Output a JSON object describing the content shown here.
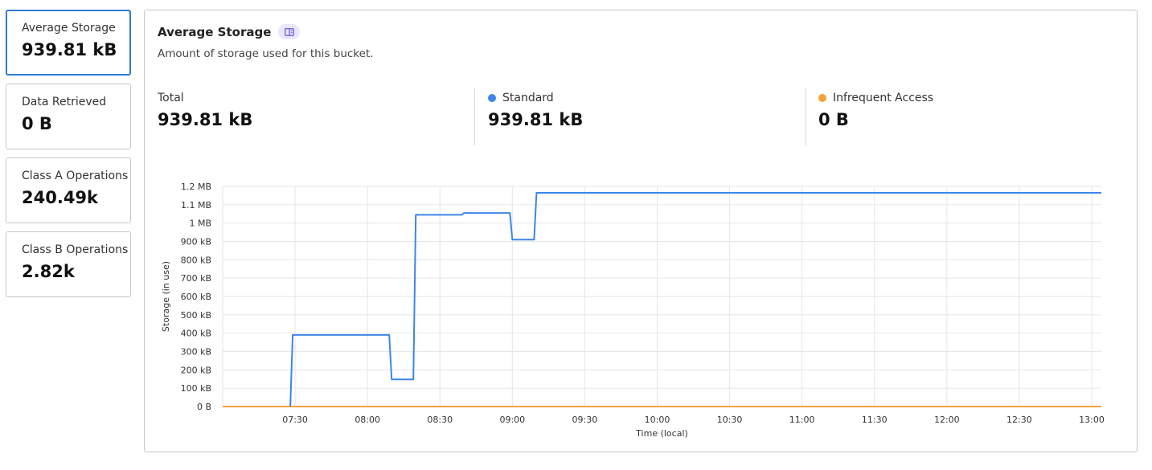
{
  "sidebar": {
    "cards": [
      {
        "label": "Average Storage",
        "value": "939.81 kB",
        "active": true
      },
      {
        "label": "Data Retrieved",
        "value": "0 B",
        "active": false
      },
      {
        "label": "Class A Operations",
        "value": "240.49k",
        "active": false
      },
      {
        "label": "Class B Operations",
        "value": "2.82k",
        "active": false
      }
    ]
  },
  "panel": {
    "title": "Average Storage",
    "subtitle": "Amount of storage used for this bucket.",
    "docs_icon": "book-icon",
    "stats": [
      {
        "label": "Total",
        "value": "939.81 kB"
      },
      {
        "label": "Standard",
        "value": "939.81 kB",
        "color": "#3b86e8"
      },
      {
        "label": "Infrequent Access",
        "value": "0 B",
        "color": "#f5a23a"
      }
    ]
  },
  "chart_data": {
    "type": "line",
    "title": "",
    "xlabel": "Time (local)",
    "ylabel": "Storage (in use)",
    "y_unit": "kB",
    "ylim": [
      0,
      1200
    ],
    "xlim": [
      "07:00",
      "13:04"
    ],
    "y_ticks": [
      {
        "value": 0,
        "label": "0 B"
      },
      {
        "value": 100,
        "label": "100 kB"
      },
      {
        "value": 200,
        "label": "200 kB"
      },
      {
        "value": 300,
        "label": "300 kB"
      },
      {
        "value": 400,
        "label": "400 kB"
      },
      {
        "value": 500,
        "label": "500 kB"
      },
      {
        "value": 600,
        "label": "600 kB"
      },
      {
        "value": 700,
        "label": "700 kB"
      },
      {
        "value": 800,
        "label": "800 kB"
      },
      {
        "value": 900,
        "label": "900 kB"
      },
      {
        "value": 1000,
        "label": "1 MB"
      },
      {
        "value": 1100,
        "label": "1.1 MB"
      },
      {
        "value": 1200,
        "label": "1.2 MB"
      }
    ],
    "x_ticks": [
      "07:30",
      "08:00",
      "08:30",
      "09:00",
      "09:30",
      "10:00",
      "10:30",
      "11:00",
      "11:30",
      "12:00",
      "12:30",
      "13:00"
    ],
    "grid": true,
    "legend": "none",
    "series": [
      {
        "name": "Standard",
        "color": "#3b86e8",
        "points": [
          [
            "07:28",
            0
          ],
          [
            "07:29",
            390
          ],
          [
            "08:09",
            390
          ],
          [
            "08:10",
            148
          ],
          [
            "08:19",
            148
          ],
          [
            "08:20",
            1045
          ],
          [
            "08:39",
            1045
          ],
          [
            "08:40",
            1055
          ],
          [
            "08:59",
            1055
          ],
          [
            "09:00",
            910
          ],
          [
            "09:09",
            910
          ],
          [
            "09:10",
            1165
          ],
          [
            "13:04",
            1165
          ]
        ]
      },
      {
        "name": "Infrequent Access",
        "color": "#f5a23a",
        "points": [
          [
            "07:00",
            0
          ],
          [
            "13:04",
            0
          ]
        ]
      }
    ]
  }
}
